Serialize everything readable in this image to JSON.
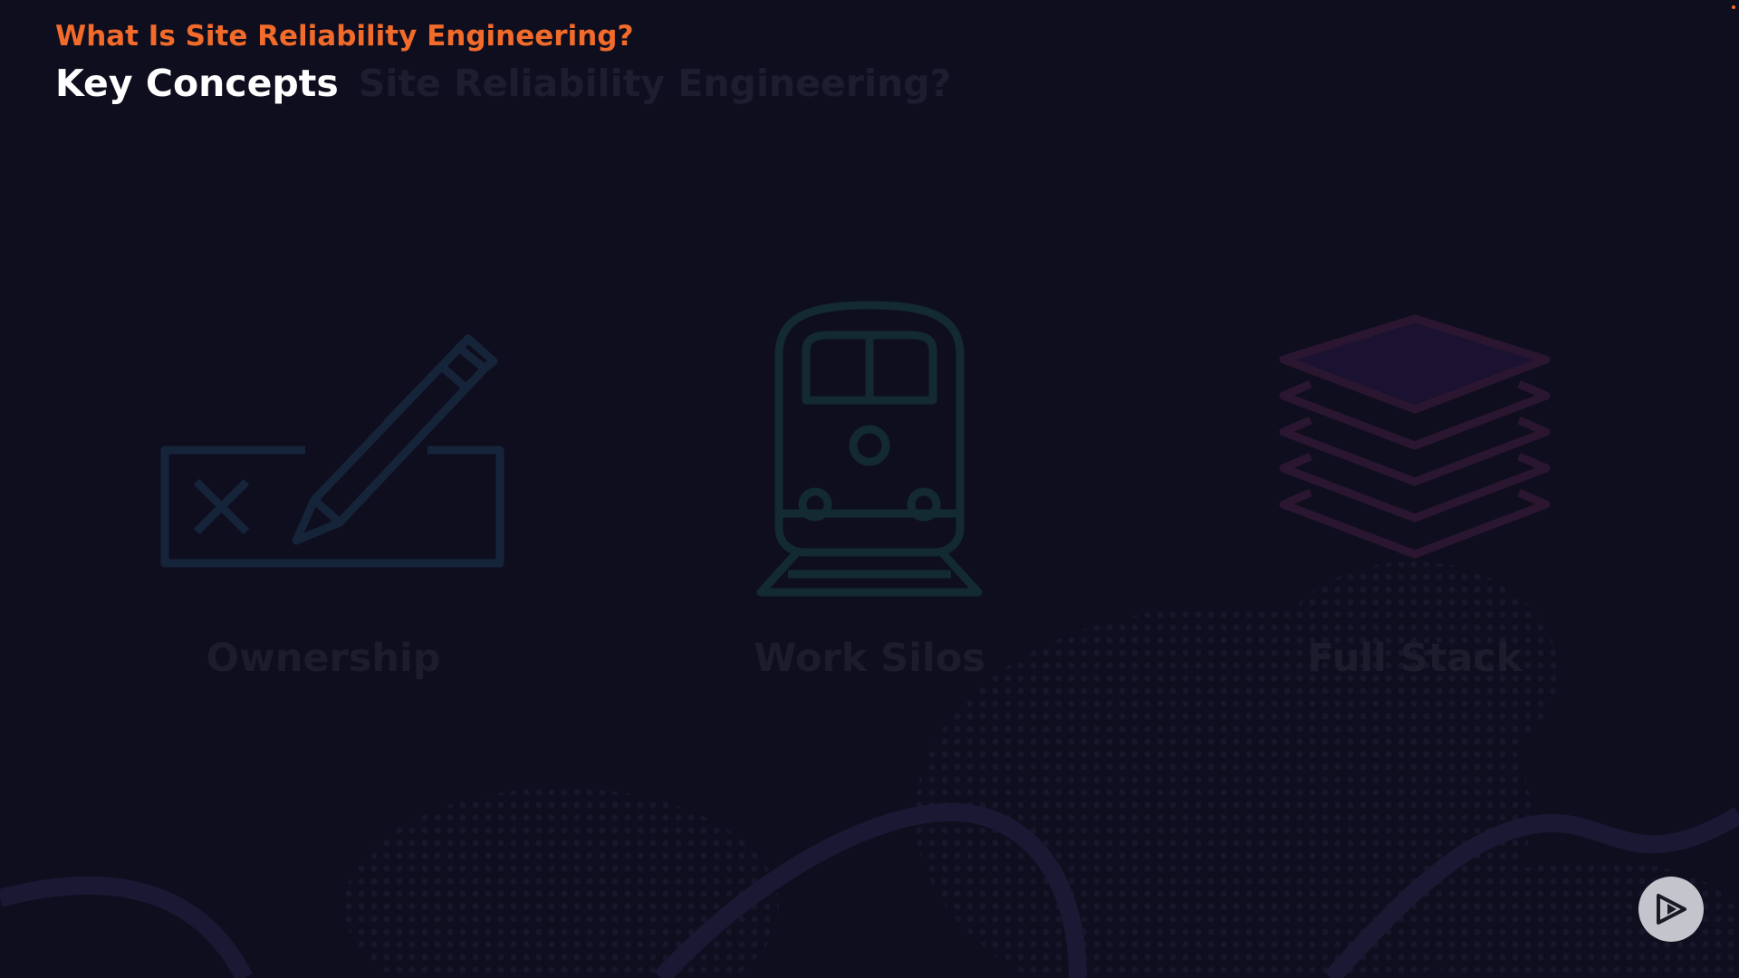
{
  "header": {
    "section_title": "What Is Site Reliability Engineering?",
    "slide_title": "Key Concepts",
    "ghost_title": "Why We Need Site Reliability Engineering?"
  },
  "concepts": [
    {
      "label": "Ownership",
      "icon": "pen-checkbox-icon"
    },
    {
      "label": "Work Silos",
      "icon": "train-icon"
    },
    {
      "label": "Full Stack",
      "icon": "layers-icon"
    }
  ],
  "player": {
    "icon": "play-icon"
  },
  "colors": {
    "background": "#0f0e1e",
    "accent": "#f26b2a",
    "title": "#ffffff",
    "ownership_icon": "#16243a",
    "work_silos_icon": "#122a30",
    "full_stack_icon": "#2a1630"
  }
}
